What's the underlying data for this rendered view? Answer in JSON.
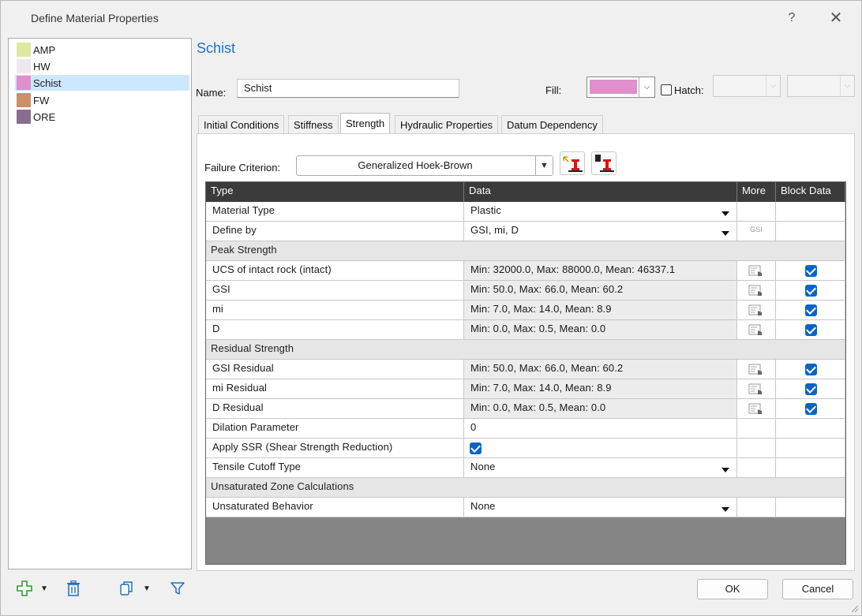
{
  "window": {
    "title": "Define Material Properties",
    "help_label": "?",
    "close_label": "✕"
  },
  "materials": [
    {
      "name": "AMP",
      "color": "#dfe8a0"
    },
    {
      "name": "HW",
      "color": "#ece8ee"
    },
    {
      "name": "Schist",
      "color": "#de8fcc",
      "selected": true
    },
    {
      "name": "FW",
      "color": "#cc8f66"
    },
    {
      "name": "ORE",
      "color": "#8a6c90"
    }
  ],
  "selected_material_title": "Schist",
  "name_field": {
    "label": "Name:",
    "value": "Schist"
  },
  "fill": {
    "label": "Fill:",
    "color": "#de8fcc"
  },
  "hatch": {
    "label": "Hatch:",
    "checked": false
  },
  "tabs": [
    "Initial Conditions",
    "Stiffness",
    "Strength",
    "Hydraulic Properties",
    "Datum Dependency"
  ],
  "active_tab": "Strength",
  "failure_criterion": {
    "label": "Failure Criterion:",
    "value": "Generalized Hoek-Brown"
  },
  "grid": {
    "headers": {
      "type": "Type",
      "data": "Data",
      "more": "More",
      "block": "Block Data"
    },
    "rows": [
      {
        "kind": "combo",
        "type": "Material Type",
        "data": "Plastic"
      },
      {
        "kind": "combo",
        "type": "Define by",
        "data": "GSI, mi, D",
        "more": "GSI"
      },
      {
        "kind": "section",
        "type": "Peak Strength"
      },
      {
        "kind": "stat",
        "type": "UCS of intact rock (intact)",
        "data": "Min: 32000.0, Max: 88000.0, Mean: 46337.1",
        "block": true
      },
      {
        "kind": "stat",
        "type": "GSI",
        "data": "Min: 50.0, Max: 66.0, Mean: 60.2",
        "block": true
      },
      {
        "kind": "stat",
        "type": "mi",
        "data": "Min: 7.0, Max: 14.0, Mean: 8.9",
        "block": true
      },
      {
        "kind": "stat",
        "type": "D",
        "data": "Min: 0.0, Max: 0.5, Mean: 0.0",
        "block": true
      },
      {
        "kind": "section",
        "type": "Residual Strength"
      },
      {
        "kind": "stat",
        "type": "GSI Residual",
        "data": "Min: 50.0, Max: 66.0, Mean: 60.2",
        "block": true
      },
      {
        "kind": "stat",
        "type": "mi Residual",
        "data": "Min: 7.0, Max: 14.0, Mean: 8.9",
        "block": true
      },
      {
        "kind": "stat",
        "type": "D Residual",
        "data": "Min: 0.0, Max: 0.5, Mean: 0.0",
        "block": true
      },
      {
        "kind": "value",
        "type": "Dilation Parameter",
        "data": "0"
      },
      {
        "kind": "check",
        "type": "Apply SSR (Shear Strength Reduction)",
        "checked": true
      },
      {
        "kind": "combo",
        "type": "Tensile Cutoff Type",
        "data": "None"
      },
      {
        "kind": "section",
        "type": "Unsaturated Zone Calculations"
      },
      {
        "kind": "combo",
        "type": "Unsaturated Behavior",
        "data": "None"
      }
    ]
  },
  "buttons": {
    "ok": "OK",
    "cancel": "Cancel"
  }
}
